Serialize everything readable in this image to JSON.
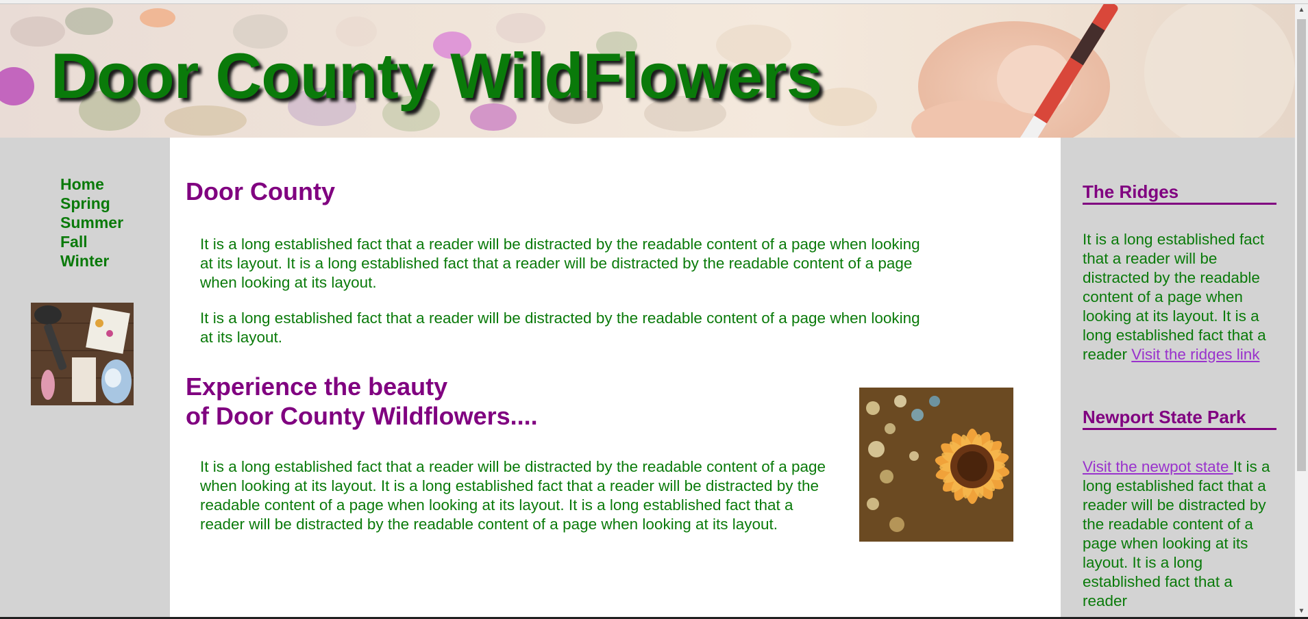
{
  "header": {
    "title": "Door County WildFlowers"
  },
  "nav": {
    "items": [
      {
        "label": "Home"
      },
      {
        "label": "Spring"
      },
      {
        "label": "Summer"
      },
      {
        "label": "Fall"
      },
      {
        "label": "Winter"
      }
    ]
  },
  "main": {
    "heading": "Door County",
    "paragraph1": "It is a long established fact that a reader will be distracted by the readable content of a page when looking at its layout. It is a long established fact that a reader will be distracted by the readable content of a page when looking at its layout.",
    "paragraph2": "It is a long established fact that a reader will be distracted by the readable content of a page when looking at its layout.",
    "subheading_line1": "Experience the beauty",
    "subheading_line2": "of Door County Wildflowers....",
    "paragraph3": "It is a long established fact that a reader will be distracted by the readable content of a page when looking at its layout. It is a long established fact that a reader will be distracted by the readable content of a page when looking at its layout. It is a long established fact that a reader will be distracted by the readable content of a page when looking at its layout."
  },
  "sidebar": {
    "ridges": {
      "heading": "The Ridges",
      "text": "It is a long established fact that a reader will be distracted by the readable content of a page when looking at its layout. It is a long established fact that a reader ",
      "link": "Visit the ridges link"
    },
    "newport": {
      "heading": "Newport State Park",
      "link": "Visit the newpot state ",
      "text": "It is a long established fact that a reader will be distracted by the readable content of a page when looking at its layout. It is a long established fact that a reader"
    }
  },
  "colors": {
    "title_green": "#0a7a0a",
    "heading_purple": "#800080",
    "link_purple": "#9932cc",
    "sidebar_gray": "#d3d3d3"
  }
}
